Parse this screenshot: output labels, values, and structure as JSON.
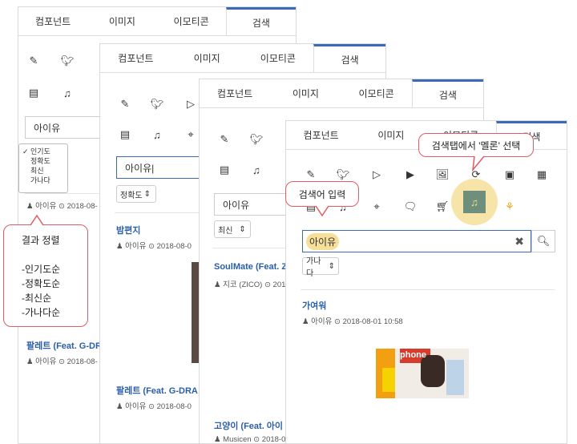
{
  "tabs": [
    "컴포넌트",
    "이미지",
    "이모티콘",
    "검색"
  ],
  "panel1": {
    "search_value": "아이유",
    "sort_dropdown": {
      "options": [
        "인기도",
        "정확도",
        "최신",
        "가나다"
      ],
      "checked": "인기도"
    },
    "meta_top": "아이유 ⊙ 2018-08-",
    "song_title": "팔레트 (Feat. G-DR",
    "song_meta": "아이유 ⊙ 2018-08-"
  },
  "panel2": {
    "search_value": "아이유|",
    "sort": "정확도",
    "song1_title": "밤편지",
    "song1_meta": "아이유 ⊙ 2018-08-0",
    "song2_title": "팔레트 (Feat. G-DRA",
    "song2_meta": "아이유 ⊙ 2018-08-0"
  },
  "panel3": {
    "search_value": "아이유",
    "sort": "최신",
    "song1_title": "SoulMate (Feat. Z",
    "song1_meta": "지코 (ZICO) ⊙ 201",
    "song2_title": "고양이 (Feat. 아이",
    "song2_meta": "Musicen ⊙ 2018-0"
  },
  "panel4": {
    "search_value": "아이유",
    "sort": "가나다",
    "song_title": "가여워",
    "song_meta": "아이유 ⊙ 2018-08-01 10:58",
    "album_art_text": "phone"
  },
  "callouts": {
    "sort": "결과 정렬\n\n-인기도순\n-정확도순\n  -최신순\n-가나다순",
    "search": "검색어 입력",
    "melon": "검색탭에서 '멜론' 선택"
  },
  "colors": {
    "accent": "#3a69b7",
    "link": "#2a5ea8",
    "callout_border": "#e15b66",
    "highlight": "#f6df99",
    "melon_green": "#6d8f7c"
  }
}
